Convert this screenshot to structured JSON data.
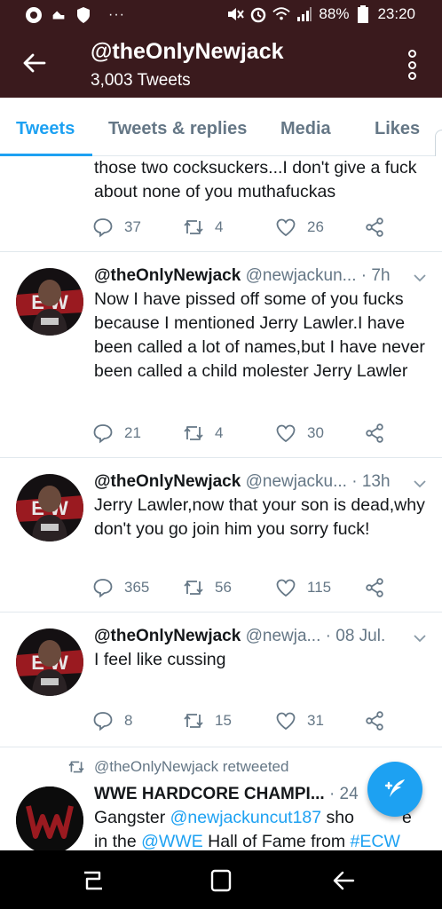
{
  "status_bar": {
    "battery": "88%",
    "time": "23:20",
    "overflow": "···",
    "icons": [
      "notification-icon",
      "cloud-icon",
      "shield-icon",
      "mute-icon",
      "alarm-icon",
      "wifi-icon",
      "signal-icon",
      "battery-icon"
    ]
  },
  "app_bar": {
    "title": "@theOnlyNewjack",
    "subtitle": "3,003 Tweets"
  },
  "tabs": [
    {
      "label": "Tweets",
      "active": true
    },
    {
      "label": "Tweets & replies",
      "active": false
    },
    {
      "label": "Media",
      "active": false
    },
    {
      "label": "Likes",
      "active": false
    }
  ],
  "tweets": [
    {
      "text": "those two cocksuckers...I don't give a fuck about none of you muthafuckas",
      "replies": "37",
      "retweets": "4",
      "likes": "26"
    },
    {
      "name": "@theOnlyNewjack",
      "handle": "@newjackun...",
      "time": "· 7h",
      "text": "Now I have pissed off some of you fucks because I mentioned Jerry Lawler.I have been called a lot of names,but I have never been called a child molester Jerry Lawler",
      "replies": "21",
      "retweets": "4",
      "likes": "30"
    },
    {
      "name": "@theOnlyNewjack",
      "handle": "@newjacku...",
      "time": "· 13h",
      "text": "Jerry Lawler,now that your son is dead,why don't you go join him you sorry fuck!",
      "replies": "365",
      "retweets": "56",
      "likes": "115"
    },
    {
      "name": "@theOnlyNewjack",
      "handle": "@newja...",
      "time": "· 08 Jul.",
      "text": "I feel like cussing",
      "replies": "8",
      "retweets": "15",
      "likes": "31"
    }
  ],
  "retweet": {
    "label": "@theOnlyNewjack retweeted",
    "name": "WWE HARDCORE CHAMPI...",
    "time": "· 24",
    "text_pre": "Gangster ",
    "mention1": "@newjackuncut187",
    "text_mid": " sho",
    "text_tail": "e",
    "line2_pre": "in the ",
    "mention2": "@WWE",
    "line2_mid": " Hall of Fame from ",
    "hashtag": "#ECW"
  },
  "colors": {
    "header_bg": "#3a1a1d",
    "accent": "#1da1f2",
    "secondary_text": "#657786",
    "nav_bg": "#000000"
  }
}
